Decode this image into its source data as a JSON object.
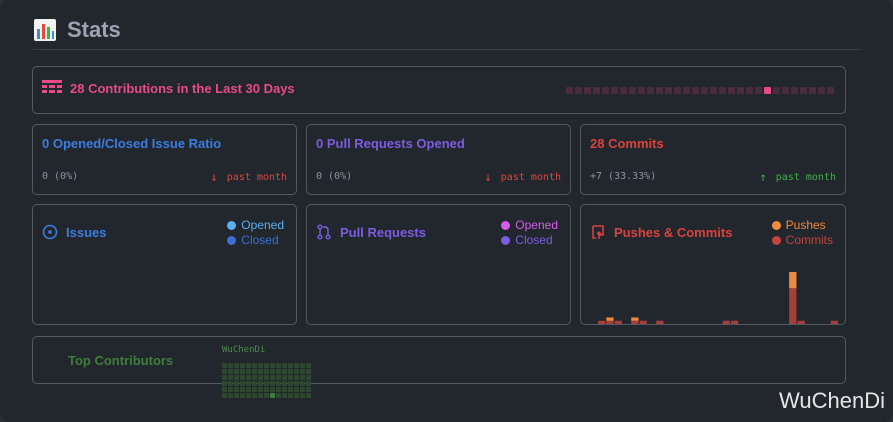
{
  "header": {
    "title": "Stats",
    "icon": "bar-chart-icon"
  },
  "contributions": {
    "label": "28 Contributions in the Last 30 Days",
    "icon": "calendar-grid-icon",
    "levels": [
      0,
      0,
      0,
      0,
      0,
      0,
      0,
      0,
      0,
      0,
      0,
      0,
      0,
      0,
      0,
      0,
      0,
      0,
      0,
      0,
      0,
      0,
      1,
      0,
      0,
      0,
      0,
      0,
      0,
      0
    ]
  },
  "stats": [
    {
      "title": "0 Opened/Closed Issue Ratio",
      "value": "0 (0%)",
      "trend": "past month",
      "direction": "down",
      "color": "#3b7de0",
      "trend_color": "#e0443c"
    },
    {
      "title": "0 Pull Requests Opened",
      "value": "0 (0%)",
      "trend": "past month",
      "direction": "down",
      "color": "#7c5ce0",
      "trend_color": "#e0443c"
    },
    {
      "title": "28 Commits",
      "value": "+7 (33.33%)",
      "trend": "past month",
      "direction": "up",
      "color": "#d9433e",
      "trend_color": "#41b046"
    }
  ],
  "panels": {
    "issues": {
      "title": "Issues",
      "icon": "issue-circle-icon",
      "color": "#3b7de0",
      "legend": [
        {
          "label": "Opened",
          "color": "#5ab0f0"
        },
        {
          "label": "Closed",
          "color": "#3b6fd0"
        }
      ]
    },
    "pull_requests": {
      "title": "Pull Requests",
      "icon": "pull-request-icon",
      "color": "#7c5ce0",
      "legend": [
        {
          "label": "Opened",
          "color": "#d65cf0"
        },
        {
          "label": "Closed",
          "color": "#7c5ce0"
        }
      ]
    },
    "pushes": {
      "title": "Pushes & Commits",
      "icon": "push-repo-icon",
      "color": "#d9433e",
      "legend": [
        {
          "label": "Pushes",
          "color": "#f08a3c"
        },
        {
          "label": "Commits",
          "color": "#c4443e"
        }
      ]
    }
  },
  "chart_data": {
    "type": "bar",
    "series": [
      {
        "name": "Pushes",
        "values": [
          0,
          1,
          0,
          0,
          1,
          0,
          0,
          0,
          0,
          0,
          0,
          0,
          0,
          0,
          0,
          0,
          0,
          0,
          0,
          0,
          0,
          0,
          0,
          5,
          0,
          0,
          0,
          0,
          0
        ]
      },
      {
        "name": "Commits",
        "values": [
          1,
          1,
          1,
          0,
          1,
          1,
          0,
          1,
          0,
          0,
          0,
          0,
          0,
          0,
          0,
          1,
          1,
          0,
          0,
          0,
          0,
          0,
          0,
          11,
          1,
          0,
          0,
          0,
          1
        ]
      }
    ],
    "colors": {
      "pushes": "#f08a3c",
      "commits": "#a83e3a"
    }
  },
  "top_contributors": {
    "label": "Top Contributors",
    "user": "WuChenDi",
    "levels": [
      0,
      0,
      0,
      0,
      0,
      0,
      0,
      0,
      0,
      0,
      0,
      0,
      0,
      0,
      0,
      0,
      0,
      0,
      0,
      0,
      0,
      0,
      0,
      0,
      0,
      0,
      0,
      0,
      0,
      0,
      0,
      0,
      0,
      0,
      0,
      0,
      0,
      0,
      0,
      0,
      0,
      0,
      0,
      0,
      0,
      0,
      0,
      0,
      0,
      0,
      0,
      0,
      0,
      0,
      0,
      0,
      0,
      0,
      0,
      0,
      0,
      0,
      0,
      0,
      0,
      0,
      0,
      0,
      0,
      0,
      0,
      0,
      0,
      0,
      0,
      0,
      0,
      0,
      0,
      0,
      0,
      0,
      0,
      1,
      0,
      0,
      0,
      0,
      0,
      0
    ]
  },
  "watermark": "WuChenDi"
}
